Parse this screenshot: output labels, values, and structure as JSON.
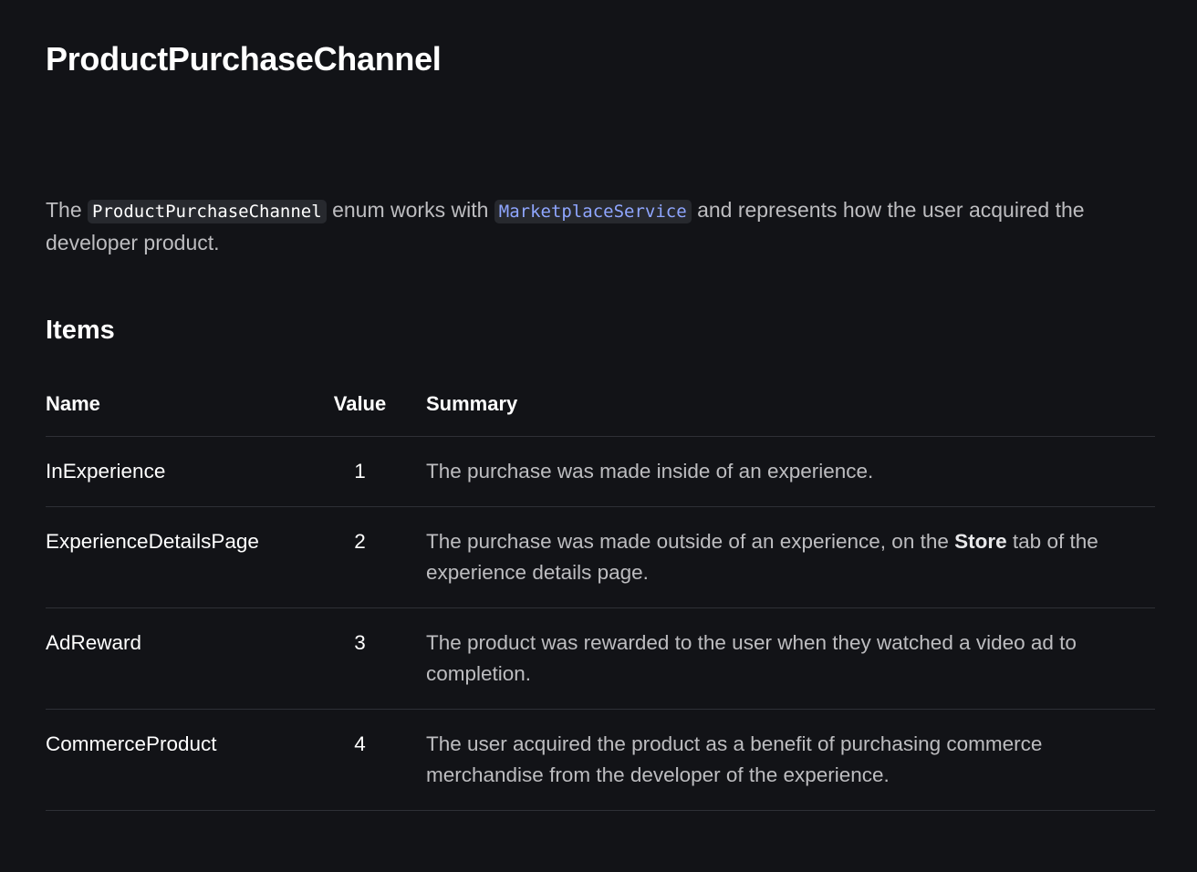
{
  "title": "ProductPurchaseChannel",
  "intro": {
    "prefix": "The",
    "enum_code": "ProductPurchaseChannel",
    "middle": "enum works with",
    "service_link": "MarketplaceService",
    "suffix": "and represents how the user acquired the developer product."
  },
  "section_title": "Items",
  "table": {
    "headers": {
      "name": "Name",
      "value": "Value",
      "summary": "Summary"
    },
    "rows": [
      {
        "name": "InExperience",
        "value": "1",
        "summary_before": "The purchase was made inside of an experience.",
        "summary_bold": "",
        "summary_after": ""
      },
      {
        "name": "ExperienceDetailsPage",
        "value": "2",
        "summary_before": "The purchase was made outside of an experience, on the",
        "summary_bold": "Store",
        "summary_after": "tab of the experience details page."
      },
      {
        "name": "AdReward",
        "value": "3",
        "summary_before": "The product was rewarded to the user when they watched a video ad to completion.",
        "summary_bold": "",
        "summary_after": ""
      },
      {
        "name": "CommerceProduct",
        "value": "4",
        "summary_before": "The user acquired the product as a benefit of purchasing commerce merchandise from the developer of the experience.",
        "summary_bold": "",
        "summary_after": ""
      }
    ]
  }
}
